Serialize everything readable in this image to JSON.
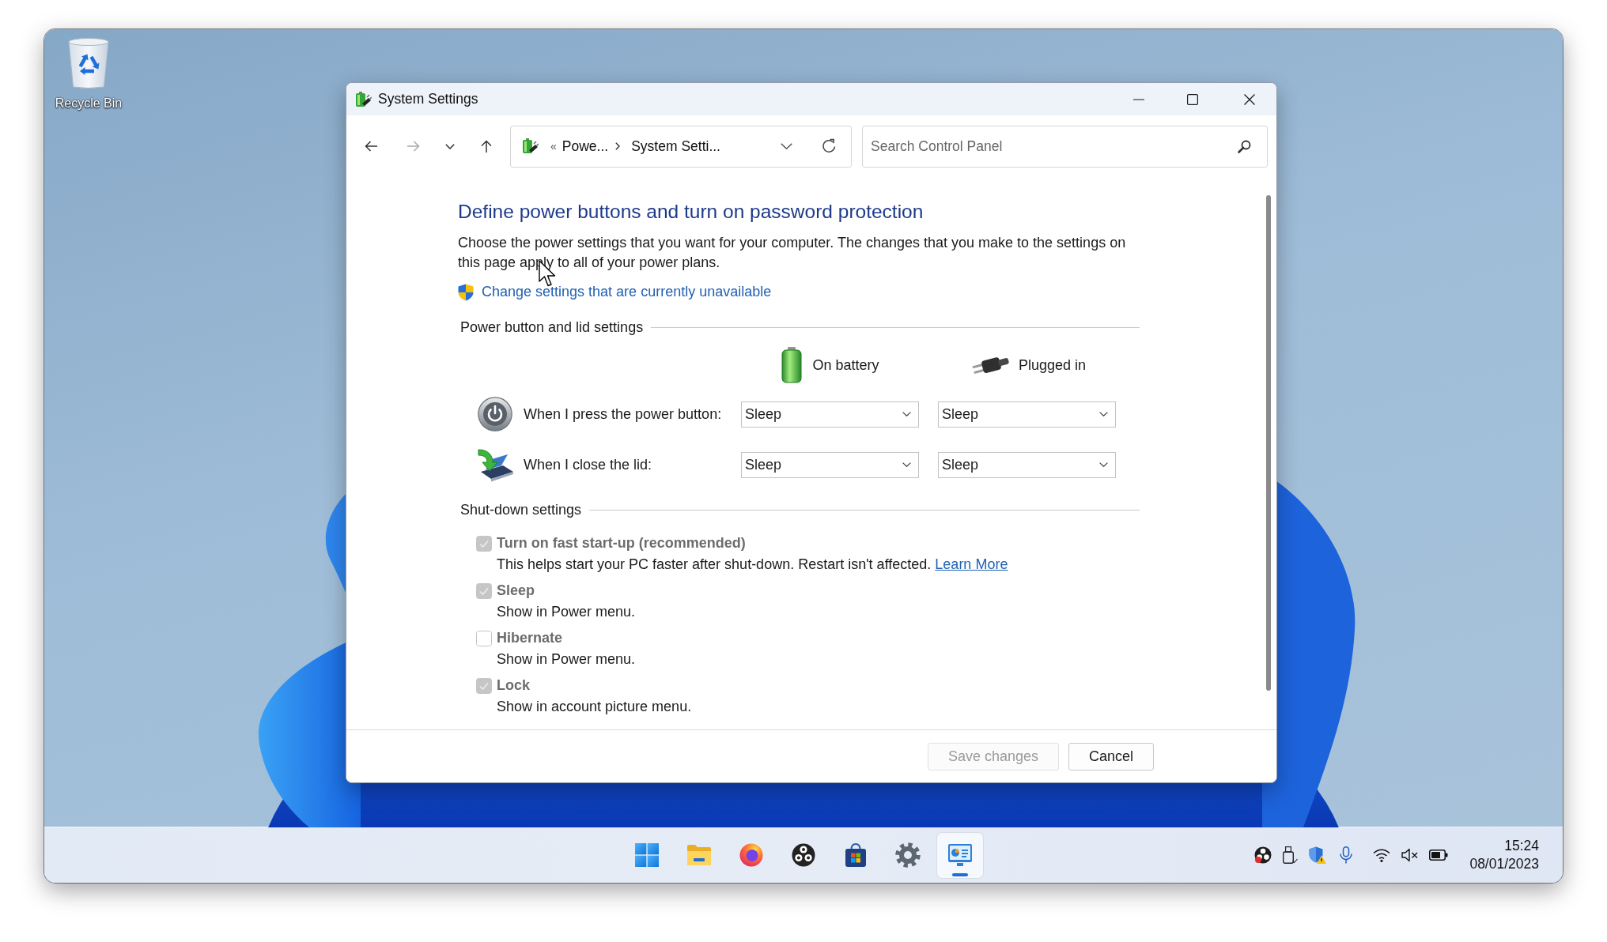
{
  "desktop": {
    "icons": [
      {
        "label": "Recycle Bin"
      }
    ]
  },
  "window": {
    "title": "System Settings"
  },
  "toolbar": {
    "nav": [
      {
        "kind": "back",
        "disabled": false
      },
      {
        "kind": "forward",
        "disabled": true
      },
      {
        "kind": "recent",
        "disabled": false
      },
      {
        "kind": "up",
        "disabled": false
      }
    ],
    "address": {
      "overflow": "«",
      "crumbs": [
        "Powe...",
        "System Setti..."
      ]
    },
    "search": {
      "placeholder": "Search Control Panel"
    }
  },
  "content": {
    "heading": "Define power buttons and turn on password protection",
    "intro": "Choose the power settings that you want for your computer. The changes that you make to the settings on this page apply to all of your power plans.",
    "admin_link": "Change settings that are currently unavailable",
    "power_section": {
      "title": "Power button and lid settings",
      "columns": [
        {
          "kind": "battery",
          "label": "On battery"
        },
        {
          "kind": "plug",
          "label": "Plugged in"
        }
      ],
      "rows": [
        {
          "kind": "power",
          "label": "When I press the power button:",
          "values": [
            "Sleep",
            "Sleep"
          ]
        },
        {
          "kind": "lid",
          "label": "When I close the lid:",
          "values": [
            "Sleep",
            "Sleep"
          ]
        }
      ]
    },
    "shutdown_section": {
      "title": "Shut-down settings",
      "options": [
        {
          "label": "Turn on fast start-up (recommended)",
          "checked": true,
          "disabled": true,
          "description": "This helps start your PC faster after shut-down. Restart isn't affected.",
          "link": "Learn More"
        },
        {
          "label": "Sleep",
          "checked": true,
          "disabled": true,
          "description": "Show in Power menu."
        },
        {
          "label": "Hibernate",
          "checked": false,
          "disabled": true,
          "description": "Show in Power menu."
        },
        {
          "label": "Lock",
          "checked": true,
          "disabled": true,
          "description": "Show in account picture menu."
        }
      ]
    }
  },
  "footer": {
    "buttons": [
      {
        "label": "Save changes",
        "disabled": true
      },
      {
        "label": "Cancel",
        "disabled": false
      }
    ]
  },
  "taskbar": {
    "apps": [
      {
        "kind": "start",
        "selected": false
      },
      {
        "kind": "files",
        "selected": false
      },
      {
        "kind": "browser",
        "selected": false
      },
      {
        "kind": "recorder",
        "selected": false
      },
      {
        "kind": "store",
        "selected": false
      },
      {
        "kind": "settings",
        "selected": false
      },
      {
        "kind": "control_panel",
        "selected": true
      }
    ],
    "clock": {
      "time": "15:24",
      "date": "08/01/2023"
    }
  }
}
